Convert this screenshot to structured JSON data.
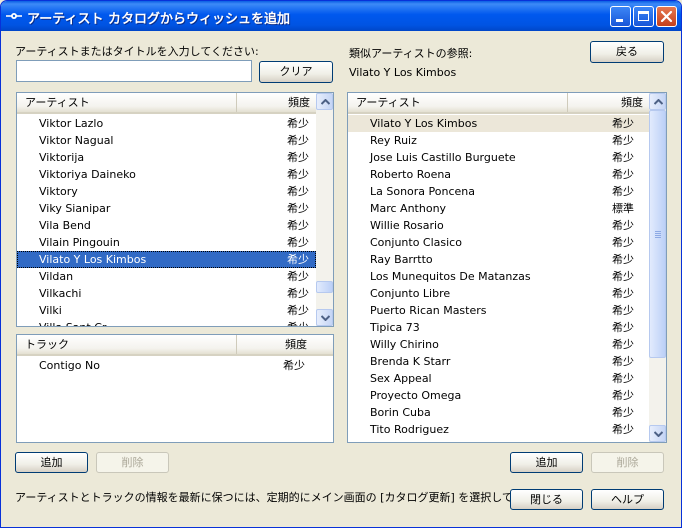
{
  "window": {
    "title": "アーティスト カタログからウィッシュを追加",
    "minimize_label": "最小化",
    "maximize_label": "最大化",
    "close_label": "閉じる"
  },
  "search": {
    "label": "アーティストまたはタイトルを入力してください:",
    "value": "",
    "placeholder": "",
    "clear_label": "クリア"
  },
  "artists": {
    "col_artist": "アーティスト",
    "col_freq": "頻度",
    "rows": [
      {
        "name": "Viktor Lazlo",
        "freq": "希少"
      },
      {
        "name": "Viktor Nagual",
        "freq": "希少"
      },
      {
        "name": "Viktorija",
        "freq": "希少"
      },
      {
        "name": "Viktoriya Daineko",
        "freq": "希少"
      },
      {
        "name": "Viktory",
        "freq": "希少"
      },
      {
        "name": "Viky Sianipar",
        "freq": "希少"
      },
      {
        "name": "Vila Bend",
        "freq": "希少"
      },
      {
        "name": "Vilain Pingouin",
        "freq": "希少"
      },
      {
        "name": "Vilato Y Los Kimbos",
        "freq": "希少"
      },
      {
        "name": "Vildan",
        "freq": "希少"
      },
      {
        "name": "Vilkachi",
        "freq": "希少"
      },
      {
        "name": "Vilki",
        "freq": "希少"
      },
      {
        "name": "Villa Sant Cr...",
        "freq": "希少"
      }
    ],
    "selected_index": 8
  },
  "tracks": {
    "col_track": "トラック",
    "col_freq": "頻度",
    "rows": [
      {
        "name": "Contigo No",
        "freq": "希少"
      }
    ]
  },
  "similar": {
    "label": "類似アーティストの参照:",
    "current": "Vilato Y Los Kimbos",
    "back_label": "戻る",
    "col_artist": "アーティスト",
    "col_freq": "頻度",
    "rows": [
      {
        "name": "Vilato Y Los Kimbos",
        "freq": "希少"
      },
      {
        "name": "Rey Ruiz",
        "freq": "希少"
      },
      {
        "name": "Jose Luis Castillo Burguete",
        "freq": "希少"
      },
      {
        "name": "Roberto Roena",
        "freq": "希少"
      },
      {
        "name": "La Sonora Poncena",
        "freq": "希少"
      },
      {
        "name": "Marc Anthony",
        "freq": "標準"
      },
      {
        "name": "Willie Rosario",
        "freq": "希少"
      },
      {
        "name": "Conjunto Clasico",
        "freq": "希少"
      },
      {
        "name": "Ray Barrtto",
        "freq": "希少"
      },
      {
        "name": "Los Munequitos De Matanzas",
        "freq": "希少"
      },
      {
        "name": "Conjunto Libre",
        "freq": "希少"
      },
      {
        "name": "Puerto Rican Masters",
        "freq": "希少"
      },
      {
        "name": "Tipica 73",
        "freq": "希少"
      },
      {
        "name": "Willy Chirino",
        "freq": "希少"
      },
      {
        "name": "Brenda K Starr",
        "freq": "希少"
      },
      {
        "name": "Sex Appeal",
        "freq": "希少"
      },
      {
        "name": "Proyecto Omega",
        "freq": "希少"
      },
      {
        "name": "Borin Cuba",
        "freq": "希少"
      },
      {
        "name": "Tito Rodriguez",
        "freq": "希少"
      }
    ],
    "highlighted_index": 0
  },
  "buttons": {
    "add_left": "追加",
    "delete_left": "削除",
    "add_right": "追加",
    "delete_right": "削除",
    "close": "閉じる",
    "help": "ヘルプ"
  },
  "footer": {
    "text": "アーティストとトラックの情報を最新に保つには、定期的にメイン画面の [カタログ更新] を選択してください。"
  },
  "colors": {
    "titlebar": "#0054e3",
    "selection": "#316ac5",
    "window_bg": "#ece9d8"
  }
}
